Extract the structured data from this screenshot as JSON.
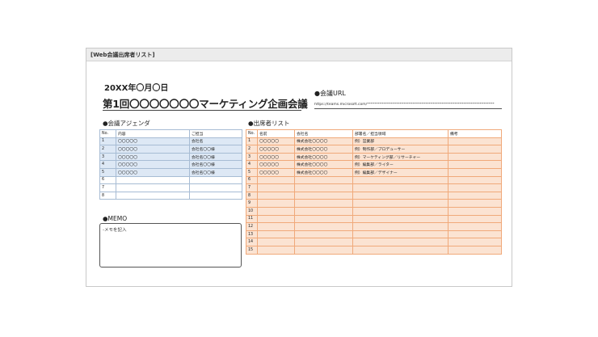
{
  "sheet_tag": "[Web会議出席者リスト]",
  "date": "20XX年〇月〇日",
  "title": "第1回〇〇〇〇〇〇〇マーケティング企画会議",
  "url_label": "●会議URL",
  "url_value": "https://teams.microsoft.com/**********************************************************************",
  "agenda": {
    "label": "●会議アジェンダ",
    "headers": [
      "No.",
      "内容",
      "ご担当"
    ],
    "rows": [
      [
        "1",
        "〇〇〇〇〇",
        "会社名"
      ],
      [
        "2",
        "〇〇〇〇〇",
        "会社名〇〇様"
      ],
      [
        "3",
        "〇〇〇〇〇",
        "会社名〇〇様"
      ],
      [
        "4",
        "〇〇〇〇〇",
        "会社名〇〇様"
      ],
      [
        "5",
        "〇〇〇〇〇",
        "会社名〇〇様"
      ],
      [
        "6",
        "",
        ""
      ],
      [
        "7",
        "",
        ""
      ],
      [
        "8",
        "",
        ""
      ]
    ]
  },
  "attendees": {
    "label": "●出席者リスト",
    "headers": [
      "No.",
      "名前",
      "会社名",
      "部署名／担当領域",
      "備考"
    ],
    "rows": [
      [
        "1",
        "〇〇〇〇〇",
        "株式会社〇〇〇〇",
        "例）営業部",
        ""
      ],
      [
        "2",
        "〇〇〇〇〇",
        "株式会社〇〇〇〇",
        "例）制作部／プロデューサー",
        ""
      ],
      [
        "3",
        "〇〇〇〇〇",
        "株式会社〇〇〇〇",
        "例）マーケティング部／リサーチャー",
        ""
      ],
      [
        "4",
        "〇〇〇〇〇",
        "株式会社〇〇〇〇",
        "例）編集部／ライター",
        ""
      ],
      [
        "5",
        "〇〇〇〇〇",
        "株式会社〇〇〇〇",
        "例）編集部／デザイナー",
        ""
      ],
      [
        "6",
        "",
        "",
        "",
        ""
      ],
      [
        "7",
        "",
        "",
        "",
        ""
      ],
      [
        "8",
        "",
        "",
        "",
        ""
      ],
      [
        "9",
        "",
        "",
        "",
        ""
      ],
      [
        "10",
        "",
        "",
        "",
        ""
      ],
      [
        "11",
        "",
        "",
        "",
        ""
      ],
      [
        "12",
        "",
        "",
        "",
        ""
      ],
      [
        "13",
        "",
        "",
        "",
        ""
      ],
      [
        "14",
        "",
        "",
        "",
        ""
      ],
      [
        "15",
        "",
        "",
        "",
        ""
      ]
    ]
  },
  "memo": {
    "label": "●MEMO",
    "text": "-メモを記入"
  }
}
